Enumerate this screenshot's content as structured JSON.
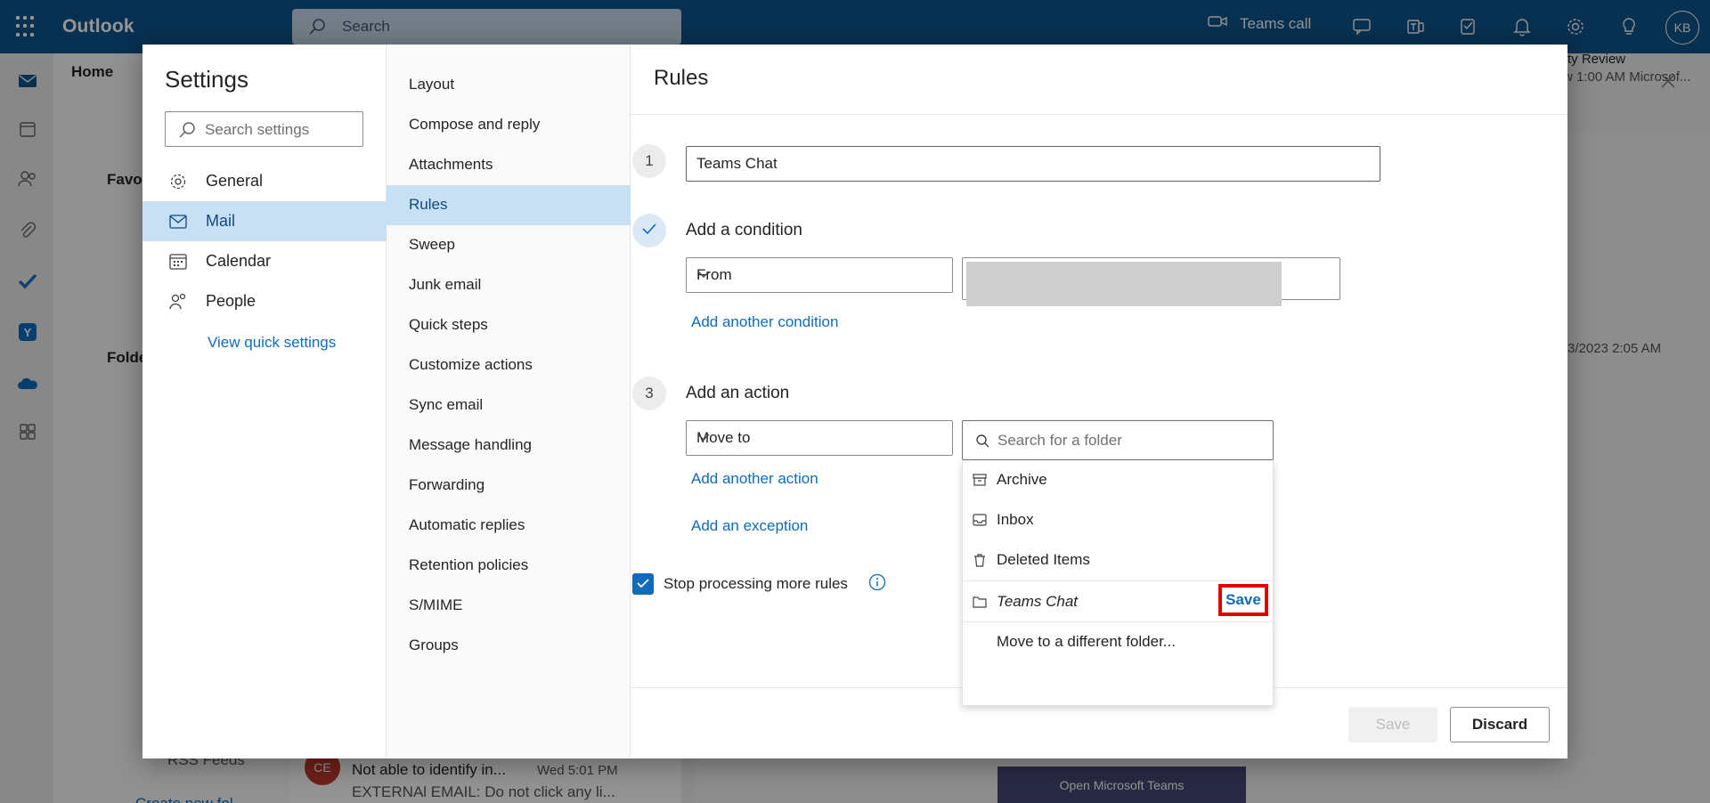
{
  "app": {
    "name": "Outlook",
    "search_placeholder": "Search",
    "teams_call": "Teams call",
    "user_initials": "KB"
  },
  "background": {
    "home_tab": "Home",
    "favorites": "Favo",
    "folders": "Folde",
    "rss_feeds": "RSS Feeds",
    "create_folder": "Create new fol",
    "read_header_title": "ty Review",
    "read_header_time": "w 1:00 AM Microsof...",
    "date_text": "3/2023 2:05 AM",
    "message": {
      "avatar": "CE",
      "subject": "Not able to identify in...",
      "date": "Wed 5:01 PM",
      "preview": "EXTERNAl EMAIL: Do not click any li..."
    },
    "teams_button": "Open Microsoft Teams"
  },
  "settings": {
    "title": "Settings",
    "search_placeholder": "Search settings",
    "categories": [
      {
        "label": "General",
        "icon": "gear-icon"
      },
      {
        "label": "Mail",
        "icon": "mail-icon"
      },
      {
        "label": "Calendar",
        "icon": "calendar-icon"
      },
      {
        "label": "People",
        "icon": "people-icon"
      }
    ],
    "selected_category": "Mail",
    "quick_settings": "View quick settings",
    "mail_sections": [
      "Layout",
      "Compose and reply",
      "Attachments",
      "Rules",
      "Sweep",
      "Junk email",
      "Quick steps",
      "Customize actions",
      "Sync email",
      "Message handling",
      "Forwarding",
      "Automatic replies",
      "Retention policies",
      "S/MIME",
      "Groups"
    ],
    "selected_section": "Rules"
  },
  "rules": {
    "title": "Rules",
    "step1_number": "1",
    "rule_name": "Teams Chat",
    "condition_label": "Add a condition",
    "condition_type": "From",
    "add_condition": "Add another condition",
    "step3_number": "3",
    "action_label": "Add an action",
    "action_type": "Move to",
    "folder_search_placeholder": "Search for a folder",
    "folders": [
      {
        "label": "Archive",
        "icon": "archive-icon"
      },
      {
        "label": "Inbox",
        "icon": "inbox-icon"
      },
      {
        "label": "Deleted Items",
        "icon": "trash-icon"
      }
    ],
    "new_folder_name": "Teams Chat",
    "new_folder_save": "Save",
    "move_different": "Move to a different folder...",
    "add_action": "Add another action",
    "add_exception": "Add an exception",
    "stop_processing": "Stop processing more rules",
    "stop_processing_checked": true,
    "save_button": "Save",
    "discard_button": "Discard"
  },
  "colors": {
    "brand_blue": "#0f548c",
    "accent": "#0f6cbd",
    "selection": "#c7e0f4",
    "highlight_red": "#e00000"
  }
}
